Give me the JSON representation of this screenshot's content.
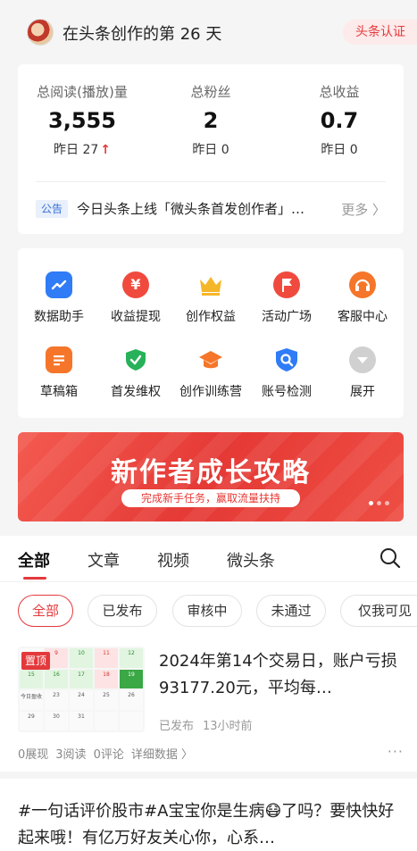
{
  "header": {
    "title": "在头条创作的第 26 天",
    "verify_label": "头条认证"
  },
  "stats": [
    {
      "label": "总阅读(播放)量",
      "value": "3,555",
      "sub": "昨日 27",
      "trend": "up"
    },
    {
      "label": "总粉丝",
      "value": "2",
      "sub": "昨日 0"
    },
    {
      "label": "总收益",
      "value": "0.7",
      "sub": "昨日 0"
    }
  ],
  "notice": {
    "tag": "公告",
    "text": "今日头条上线「微头条首发创作者」…",
    "more": "更多 〉"
  },
  "tools": [
    {
      "label": "数据助手",
      "icon": "chart-icon",
      "color": "#2f7cf6"
    },
    {
      "label": "收益提现",
      "icon": "yen-icon",
      "color": "#f04a3e"
    },
    {
      "label": "创作权益",
      "icon": "crown-icon",
      "color": "#f5b72a"
    },
    {
      "label": "活动广场",
      "icon": "flag-icon",
      "color": "#f04a3e"
    },
    {
      "label": "客服中心",
      "icon": "headset-icon",
      "color": "#f5762a"
    },
    {
      "label": "草稿箱",
      "icon": "draft-icon",
      "color": "#f5762a"
    },
    {
      "label": "首发维权",
      "icon": "shield-check-icon",
      "color": "#27b15a"
    },
    {
      "label": "创作训练营",
      "icon": "graduation-cap-icon",
      "color": "#f5762a"
    },
    {
      "label": "账号检测",
      "icon": "account-check-icon",
      "color": "#2f7cf6"
    },
    {
      "label": "展开",
      "icon": "chevron-down-icon",
      "color": "#d0d0d0"
    }
  ],
  "banner": {
    "title": "新作者成长攻略",
    "subtitle": "完成新手任务，赢取流量扶持"
  },
  "tabs": [
    {
      "label": "全部",
      "active": true
    },
    {
      "label": "文章"
    },
    {
      "label": "视频"
    },
    {
      "label": "微头条"
    }
  ],
  "filters": [
    {
      "label": "全部",
      "active": true
    },
    {
      "label": "已发布"
    },
    {
      "label": "审核中"
    },
    {
      "label": "未通过"
    },
    {
      "label": "仅我可见"
    }
  ],
  "article": {
    "pin_tag": "置顶",
    "title": "2024年第14个交易日，账户亏损93177.20元，平均每…",
    "status": "已发布",
    "time": "13小时前",
    "views": "0展现",
    "reads": "3阅读",
    "comments": "0评论",
    "details": "详细数据 〉",
    "thumb_cells": [
      "",
      "9",
      "10",
      "11",
      "12",
      "15",
      "16",
      "17",
      "18",
      "19",
      "今日盈收",
      "23",
      "24",
      "25",
      "26",
      "29",
      "30",
      "31",
      "",
      ""
    ]
  },
  "post": {
    "text": "#一句话评价股市#A宝宝你是生病😷了吗？要快快好起来哦！有亿万好友关心你，心系…"
  }
}
